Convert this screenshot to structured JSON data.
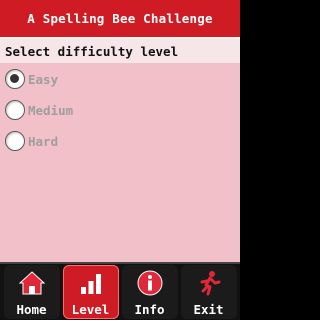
{
  "title": "A Spelling Bee Challenge",
  "subtitle": "Select difficulty level",
  "options": [
    {
      "label": "Easy",
      "selected": true
    },
    {
      "label": "Medium",
      "selected": false
    },
    {
      "label": "Hard",
      "selected": false
    }
  ],
  "nav": [
    {
      "label": "Home",
      "icon": "house-icon",
      "active": false
    },
    {
      "label": "Level",
      "icon": "bar-chart-icon",
      "active": true
    },
    {
      "label": "Info",
      "icon": "info-icon",
      "active": false
    },
    {
      "label": "Exit",
      "icon": "running-man-icon",
      "active": false
    }
  ],
  "colors": {
    "accent": "#cf1c24",
    "background": "#f2c0c8",
    "subheader": "#f6e6e8",
    "navbar": "#111111"
  }
}
